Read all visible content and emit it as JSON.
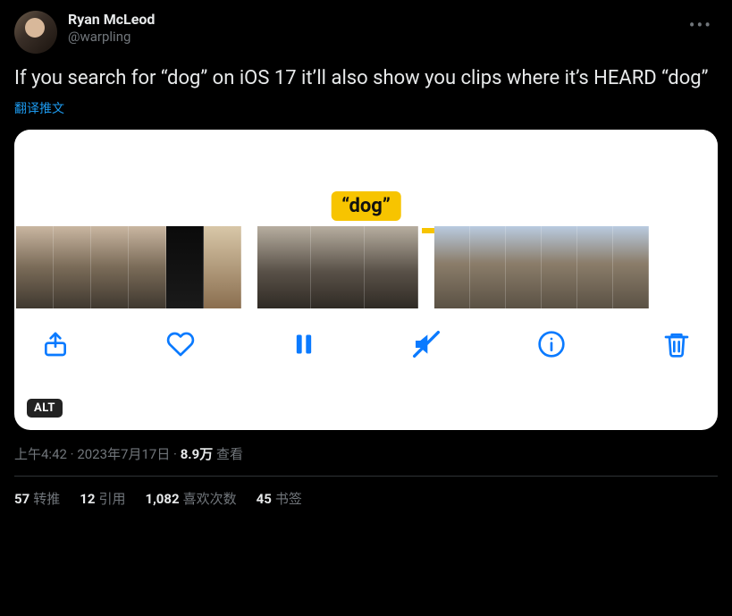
{
  "author": {
    "display_name": "Ryan McLeod",
    "handle": "@warpling"
  },
  "tweet_text": "If you search for “dog” on iOS 17 it’ll also show you clips where it’s HEARD “dog”",
  "translate_label": "翻译推文",
  "dog_label": "“dog”",
  "alt_badge": "ALT",
  "meta": {
    "time": "上午4:42",
    "date": "2023年7月17日",
    "views_count": "8.9万",
    "views_label": "查看",
    "separator": " · "
  },
  "stats": {
    "retweets": {
      "count": "57",
      "label": "转推"
    },
    "quotes": {
      "count": "12",
      "label": "引用"
    },
    "likes": {
      "count": "1,082",
      "label": "喜欢次数"
    },
    "bookmarks": {
      "count": "45",
      "label": "书签"
    }
  },
  "icons": {
    "more": "•••",
    "share": "share-icon",
    "heart": "heart-icon",
    "pause": "pause-icon",
    "mute": "volume-mute-icon",
    "info": "info-icon",
    "trash": "trash-icon"
  }
}
